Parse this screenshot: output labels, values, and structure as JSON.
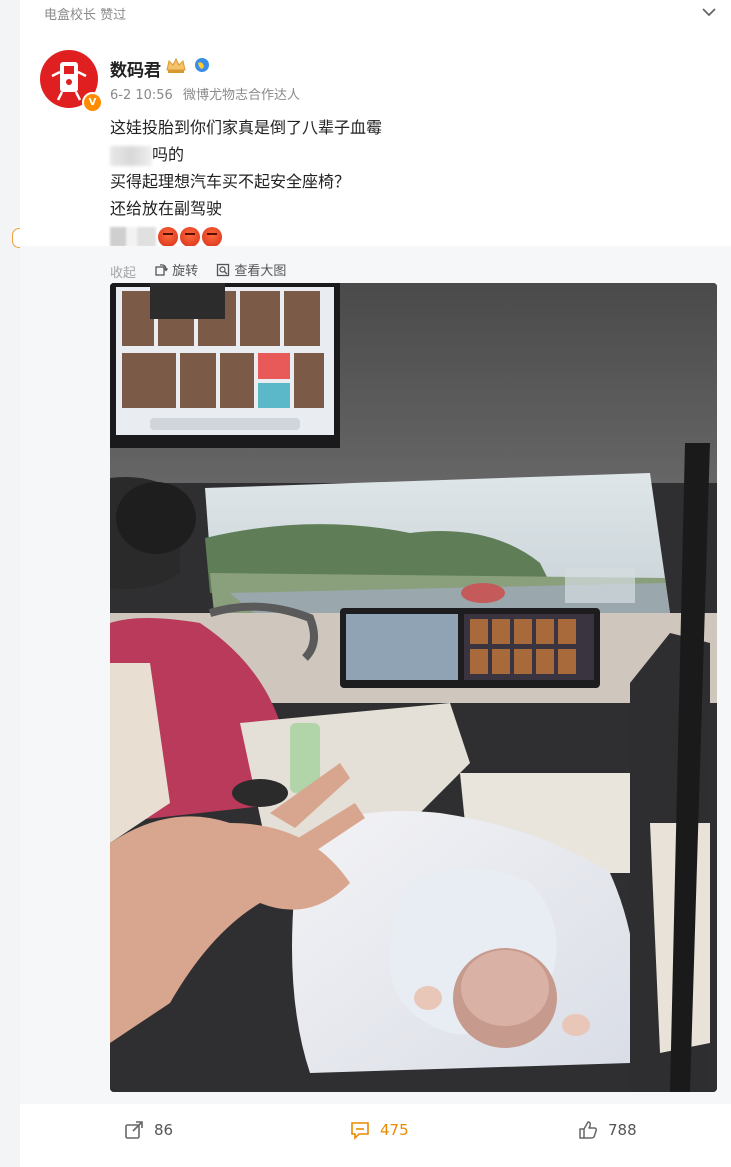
{
  "topbar": {
    "breadcrumb": "电盒校长 赞过"
  },
  "author": {
    "name": "数码君",
    "badge": "V"
  },
  "meta": {
    "time": "6-2 10:56",
    "source": "微博尤物志合作达人"
  },
  "post": {
    "line1": "这娃投胎到你们家真是倒了八辈子血霉",
    "line2_suffix": "吗的",
    "line3": "买得起理想汽车买不起安全座椅？",
    "line4": "还给放在副驾驶"
  },
  "media_tools": {
    "collapse": "收起",
    "rotate": "旋转",
    "view_large": "查看大图"
  },
  "actions": {
    "repost_count": "86",
    "comment_count": "475",
    "like_count": "788"
  },
  "colors": {
    "accent": "#ea8a00",
    "avatar": "#e02020",
    "badge": "#ff8c00"
  },
  "icons": [
    "chevron-down-icon",
    "crown-icon",
    "globe-icon",
    "rotate-icon",
    "zoom-icon",
    "repost-icon",
    "comment-icon",
    "like-icon"
  ]
}
